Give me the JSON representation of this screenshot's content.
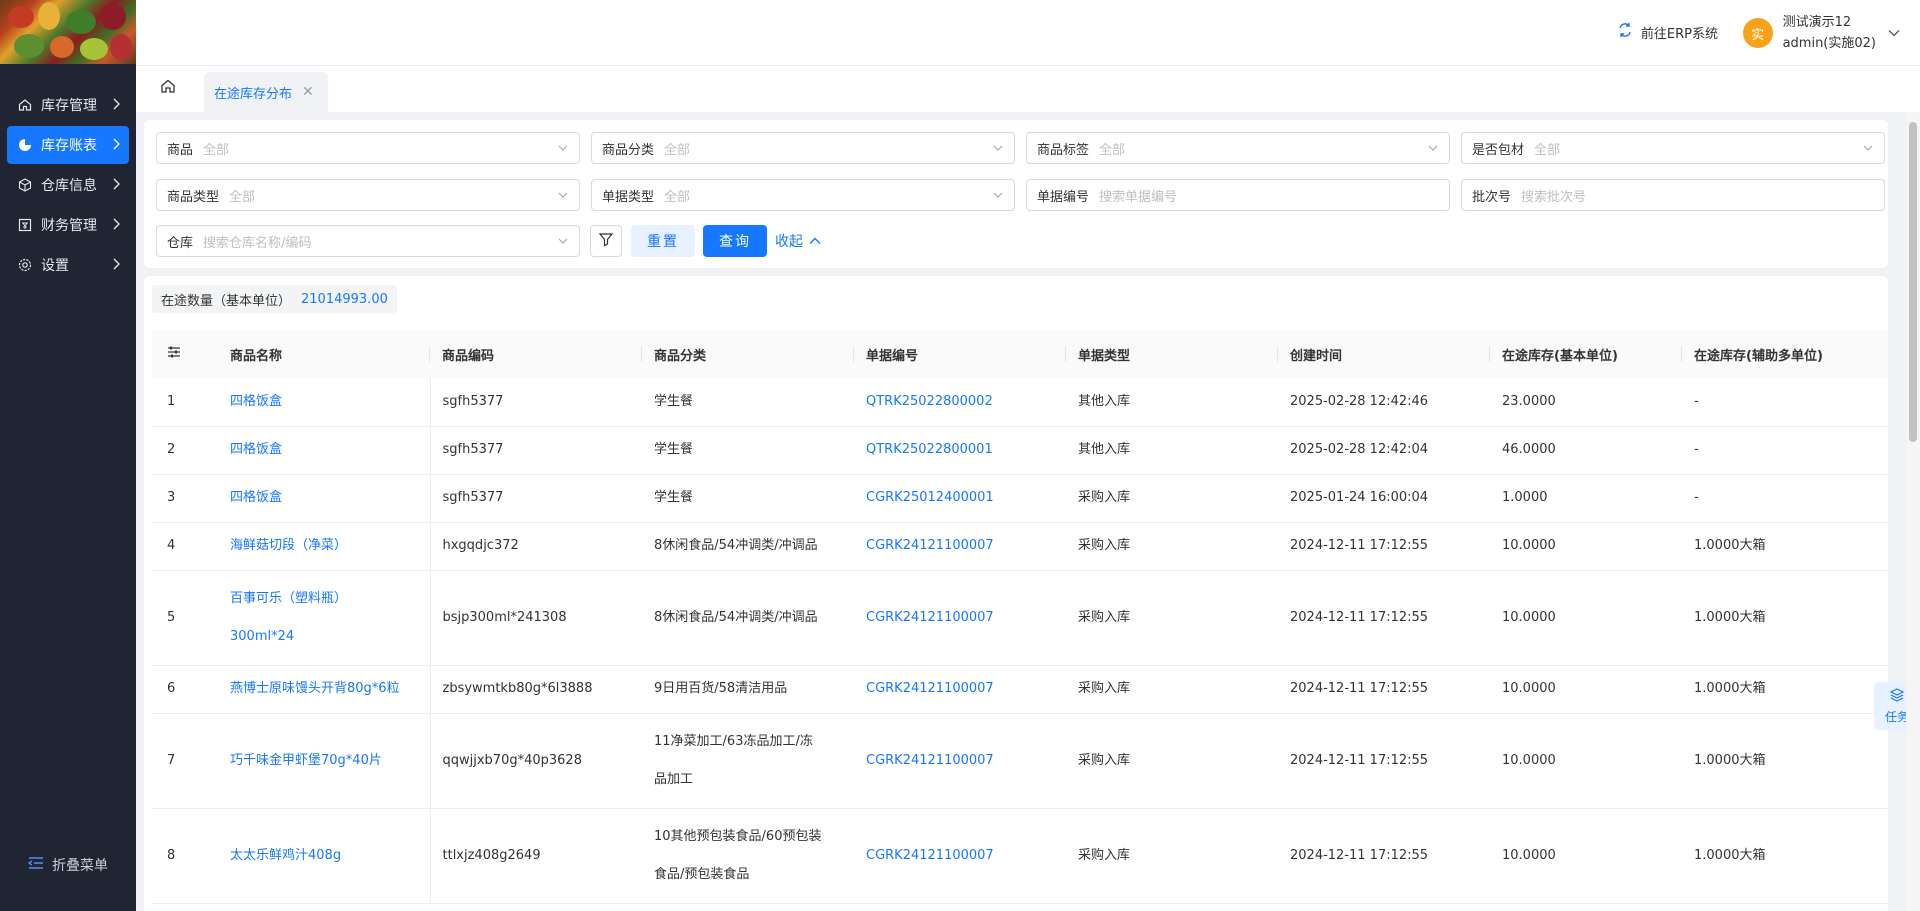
{
  "sidebar": {
    "items": [
      {
        "label": "库存管理",
        "icon": "home-icon",
        "active": false
      },
      {
        "label": "库存账表",
        "icon": "pie-chart-icon",
        "active": true
      },
      {
        "label": "仓库信息",
        "icon": "cube-icon",
        "active": false
      },
      {
        "label": "财务管理",
        "icon": "ledger-icon",
        "active": false
      },
      {
        "label": "设置",
        "icon": "gear-icon",
        "active": false
      }
    ],
    "collapse_label": "折叠菜单"
  },
  "header": {
    "erp_link": "前往ERP系统",
    "user_avatar": "实",
    "user_name": "测试演示12",
    "user_account": "admin(实施02)"
  },
  "tabs": {
    "active_tab": "在途库存分布"
  },
  "filters": {
    "product": {
      "label": "商品",
      "value": "全部"
    },
    "category": {
      "label": "商品分类",
      "value": "全部"
    },
    "tag": {
      "label": "商品标签",
      "value": "全部"
    },
    "packaging": {
      "label": "是否包材",
      "value": "全部"
    },
    "product_type": {
      "label": "商品类型",
      "value": "全部"
    },
    "doc_type": {
      "label": "单据类型",
      "value": "全部"
    },
    "doc_no": {
      "label": "单据编号",
      "placeholder": "搜索单据编号"
    },
    "batch_no": {
      "label": "批次号",
      "placeholder": "搜索批次号"
    },
    "warehouse": {
      "label": "仓库",
      "placeholder": "搜索仓库名称/编码"
    },
    "reset_label": "重置",
    "query_label": "查询",
    "fold_label": "收起"
  },
  "summary": {
    "label": "在途数量（基本单位）",
    "value": "21014993.00"
  },
  "table": {
    "columns": [
      "商品名称",
      "商品编码",
      "商品分类",
      "单据编号",
      "单据类型",
      "创建时间",
      "在途库存(基本单位)",
      "在途库存(辅助多单位)"
    ],
    "rows": [
      {
        "idx": "1",
        "name": [
          "四格饭盒"
        ],
        "code": "sgfh5377",
        "cat": [
          "学生餐"
        ],
        "doc": "QTRK25022800002",
        "type": "其他入库",
        "time": "2025-02-28 12:42:46",
        "base": "23.0000",
        "aux": "-",
        "h": 48
      },
      {
        "idx": "2",
        "name": [
          "四格饭盒"
        ],
        "code": "sgfh5377",
        "cat": [
          "学生餐"
        ],
        "doc": "QTRK25022800001",
        "type": "其他入库",
        "time": "2025-02-28 12:42:04",
        "base": "46.0000",
        "aux": "-",
        "h": 48
      },
      {
        "idx": "3",
        "name": [
          "四格饭盒"
        ],
        "code": "sgfh5377",
        "cat": [
          "学生餐"
        ],
        "doc": "CGRK25012400001",
        "type": "采购入库",
        "time": "2025-01-24 16:00:04",
        "base": "1.0000",
        "aux": "-",
        "h": 48
      },
      {
        "idx": "4",
        "name": [
          "海鲜菇切段（净菜）"
        ],
        "code": "hxgqdjc372",
        "cat": [
          "8休闲食品/54冲调类/冲调品"
        ],
        "doc": "CGRK24121100007",
        "type": "采购入库",
        "time": "2024-12-11 17:12:55",
        "base": "10.0000",
        "aux": "1.0000大箱",
        "h": 48
      },
      {
        "idx": "5",
        "name": [
          "百事可乐（塑料瓶）",
          "300ml*24"
        ],
        "code": "bsjp300ml*241308",
        "cat": [
          "8休闲食品/54冲调类/冲调品"
        ],
        "doc": "CGRK24121100007",
        "type": "采购入库",
        "time": "2024-12-11 17:12:55",
        "base": "10.0000",
        "aux": "1.0000大箱",
        "h": 95
      },
      {
        "idx": "6",
        "name": [
          "燕博士原味馒头开背80g*6粒"
        ],
        "code": "zbsywmtkb80g*6l3888",
        "cat": [
          "9日用百货/58清洁用品"
        ],
        "doc": "CGRK24121100007",
        "type": "采购入库",
        "time": "2024-12-11 17:12:55",
        "base": "10.0000",
        "aux": "1.0000大箱",
        "h": 48
      },
      {
        "idx": "7",
        "name": [
          "巧千味金甲虾堡70g*40片"
        ],
        "code": "qqwjjxb70g*40p3628",
        "cat": [
          "11净菜加工/63冻品加工/冻",
          "品加工"
        ],
        "doc": "CGRK24121100007",
        "type": "采购入库",
        "time": "2024-12-11 17:12:55",
        "base": "10.0000",
        "aux": "1.0000大箱",
        "h": 95
      },
      {
        "idx": "8",
        "name": [
          "太太乐鲜鸡汁408g"
        ],
        "code": "ttlxjz408g2649",
        "cat": [
          "10其他预包装食品/60预包装",
          "食品/预包装食品"
        ],
        "doc": "CGRK24121100007",
        "type": "采购入库",
        "time": "2024-12-11 17:12:55",
        "base": "10.0000",
        "aux": "1.0000大箱",
        "h": 95
      }
    ]
  },
  "task_float": {
    "label": "任务"
  }
}
